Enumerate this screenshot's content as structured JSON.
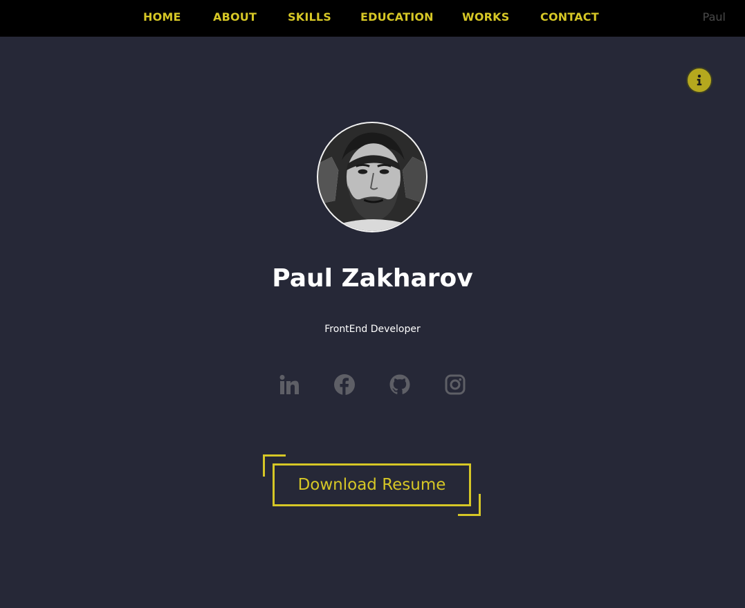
{
  "nav": {
    "items": [
      {
        "label": "HOME"
      },
      {
        "label": "ABOUT"
      },
      {
        "label": "SKILLS"
      },
      {
        "label": "EDUCATION"
      },
      {
        "label": "WORKS"
      },
      {
        "label": "CONTACT"
      }
    ],
    "brand": "Paul"
  },
  "hero": {
    "name": "Paul Zakharov",
    "role": "FrontEnd Developer",
    "resume_label": "Download Resume"
  },
  "social": [
    "linkedin-icon",
    "facebook-icon",
    "github-icon",
    "instagram-icon"
  ],
  "icons": {
    "info": "info-icon",
    "avatar": "profile-photo"
  },
  "colors": {
    "background": "#262837",
    "topbar": "#000000",
    "accent": "#d6c726",
    "nav_text": "#d6c726",
    "brand_text": "#4a4a4a",
    "social_icon": "#5e5f66",
    "info_bg": "#b5a81e",
    "text": "#ffffff"
  }
}
